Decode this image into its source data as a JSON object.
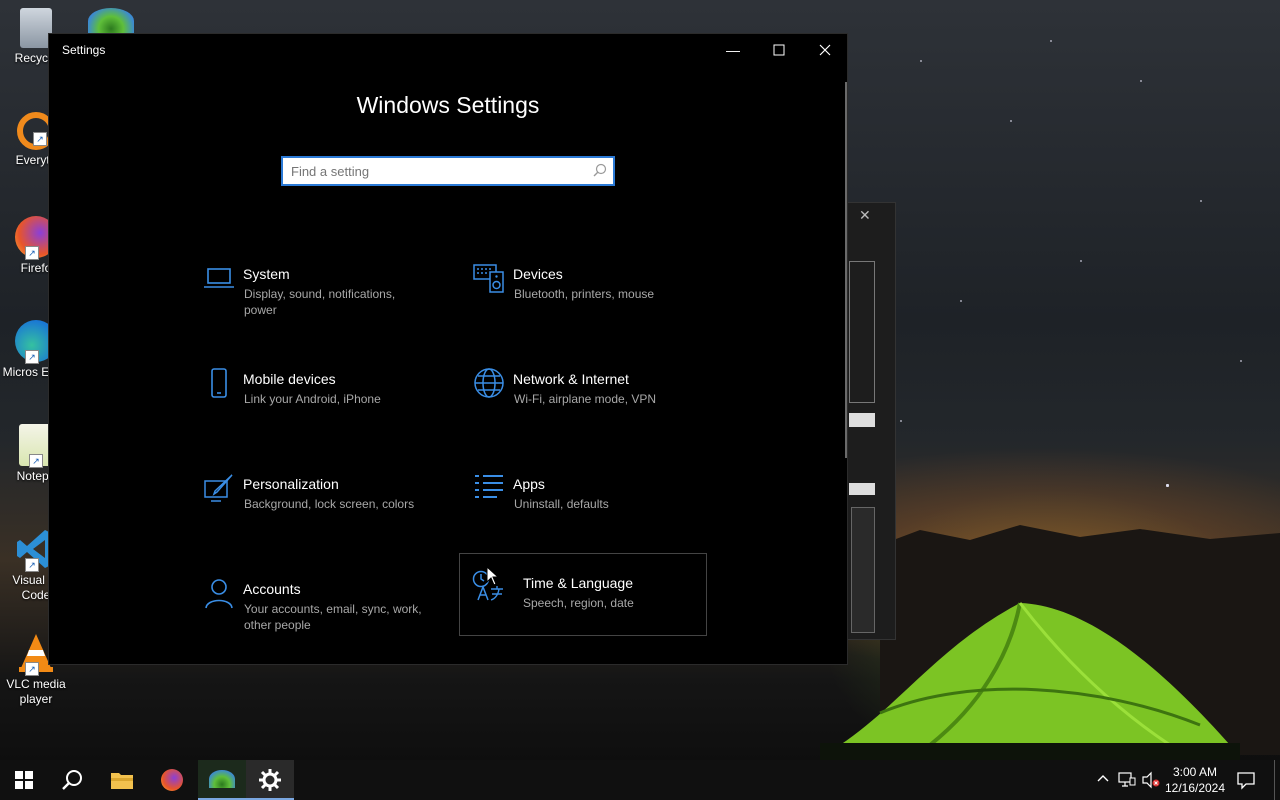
{
  "desktop": {
    "icons": [
      {
        "label": "Recycle",
        "icon": "recycle-bin-icon"
      },
      {
        "label": "Everyth",
        "icon": "everything-search-icon"
      },
      {
        "label": "Firefo",
        "icon": "firefox-icon"
      },
      {
        "label": "Micros Edge",
        "icon": "edge-icon"
      },
      {
        "label": "Notepa",
        "icon": "notepad-plus-icon"
      },
      {
        "label": "Visual St Code",
        "icon": "vscode-icon"
      },
      {
        "label": "VLC media player",
        "icon": "vlc-icon"
      }
    ]
  },
  "window": {
    "title": "Settings",
    "heading": "Windows Settings",
    "search_placeholder": "Find a setting",
    "tiles": [
      {
        "name": "System",
        "desc": "Display, sound, notifications, power",
        "icon": "laptop-icon"
      },
      {
        "name": "Devices",
        "desc": "Bluetooth, printers, mouse",
        "icon": "keyboard-speaker-icon"
      },
      {
        "name": "Mobile devices",
        "desc": "Link your Android, iPhone",
        "icon": "phone-icon"
      },
      {
        "name": "Network & Internet",
        "desc": "Wi-Fi, airplane mode, VPN",
        "icon": "globe-icon"
      },
      {
        "name": "Personalization",
        "desc": "Background, lock screen, colors",
        "icon": "paint-icon"
      },
      {
        "name": "Apps",
        "desc": "Uninstall, defaults",
        "icon": "apps-list-icon"
      },
      {
        "name": "Accounts",
        "desc": "Your accounts, email, sync, work, other people",
        "icon": "person-icon"
      },
      {
        "name": "Time & Language",
        "desc": "Speech, region, date",
        "icon": "time-language-icon"
      }
    ]
  },
  "taskbar": {
    "time": "3:00 AM",
    "date": "12/16/2024",
    "apps": [
      "start-icon",
      "search-icon",
      "file-explorer-icon",
      "firefox-icon",
      "network-app-icon",
      "settings-icon"
    ]
  },
  "colors": {
    "accent": "#2b7ad6",
    "window_bg": "#000000",
    "taskbar_bg": "#101010"
  }
}
